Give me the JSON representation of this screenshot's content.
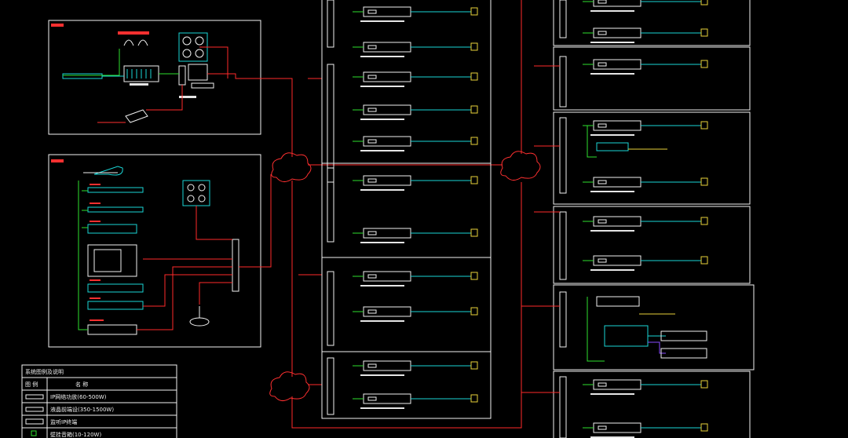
{
  "colors": {
    "background": "#000000",
    "frame": "#f2f2f2",
    "wire_red": "#ff2a2a",
    "wire_cyan": "#1ad6d6",
    "wire_green": "#2ee02e",
    "device_white": "#f0f0f0",
    "label_red": "#ff3b3b",
    "speaker_yellow": "#e8d23a",
    "cloud_red": "#ff3030"
  },
  "legend": {
    "title": "系统图例及说明",
    "col_symbol": "图 例",
    "col_name": "名 称",
    "rows": [
      {
        "icon": "amplifier-icon",
        "text": "IP网络功放(60-500W)"
      },
      {
        "icon": "amplifier-icon",
        "text": "液晶前端设(350-1500W)"
      },
      {
        "icon": "terminal-icon",
        "text": "监听IP终端"
      },
      {
        "icon": "speaker-icon",
        "text": "壁挂音箱(10-120W)"
      }
    ]
  }
}
